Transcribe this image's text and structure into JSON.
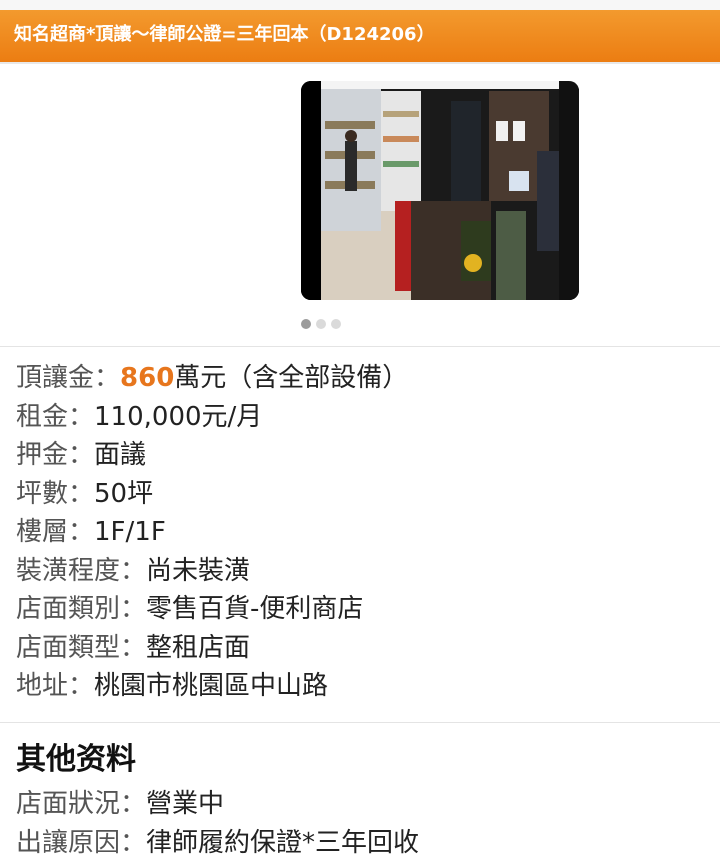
{
  "listing": {
    "title": "知名超商*頂讓～律師公證=三年回本（D124206）"
  },
  "gallery": {
    "image_alt": "store interior photo",
    "slides": 3,
    "active_slide": 1
  },
  "details": {
    "transfer_fee_label": "頂讓金：",
    "transfer_fee_amount": "860",
    "transfer_fee_suffix": "萬元（含全部設備）",
    "rent_label": "租金：",
    "rent_value": "110,000元/月",
    "deposit_label": "押金：",
    "deposit_value": "面議",
    "area_label": "坪數：",
    "area_value": "50坪",
    "floor_label": "樓層：",
    "floor_value": "1F/1F",
    "renovation_label": "裝潢程度：",
    "renovation_value": "尚未裝潢",
    "category_label": "店面類別：",
    "category_value": "零售百貨-便利商店",
    "type_label": "店面類型：",
    "type_value": "整租店面",
    "address_label": "地址：",
    "address_value": "桃園市桃園區中山路"
  },
  "other_info": {
    "heading": "其他资料",
    "status_label": "店面狀況：",
    "status_value": "營業中",
    "reason_label": "出讓原因：",
    "reason_value": "律師履約保證*三年回收"
  },
  "colors": {
    "header_orange": "#ec7d12",
    "price_orange": "#e7761d"
  }
}
